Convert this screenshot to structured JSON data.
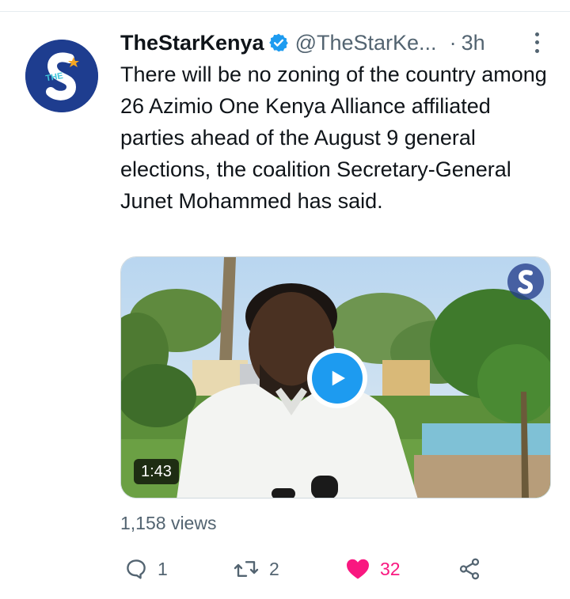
{
  "tweet": {
    "display_name": "TheStarKenya",
    "verified": true,
    "handle": "@TheStarKe...",
    "separator": "·",
    "time": "3h",
    "text": "There will be no zoning of the country among 26 Azimio One Kenya Alliance affiliated parties ahead of the August 9 general elections, the coalition Secretary-General Junet Mohammed has said.",
    "avatar_letters": "THE",
    "video": {
      "duration": "1:43",
      "has_play_button": true
    },
    "views": "1,158 views",
    "actions": {
      "reply_count": "1",
      "retweet_count": "2",
      "like_count": "32"
    }
  },
  "colors": {
    "accent": "#1d9bf0",
    "like": "#f91880",
    "muted": "#536471",
    "avatar_bg": "#1d3a8a"
  }
}
